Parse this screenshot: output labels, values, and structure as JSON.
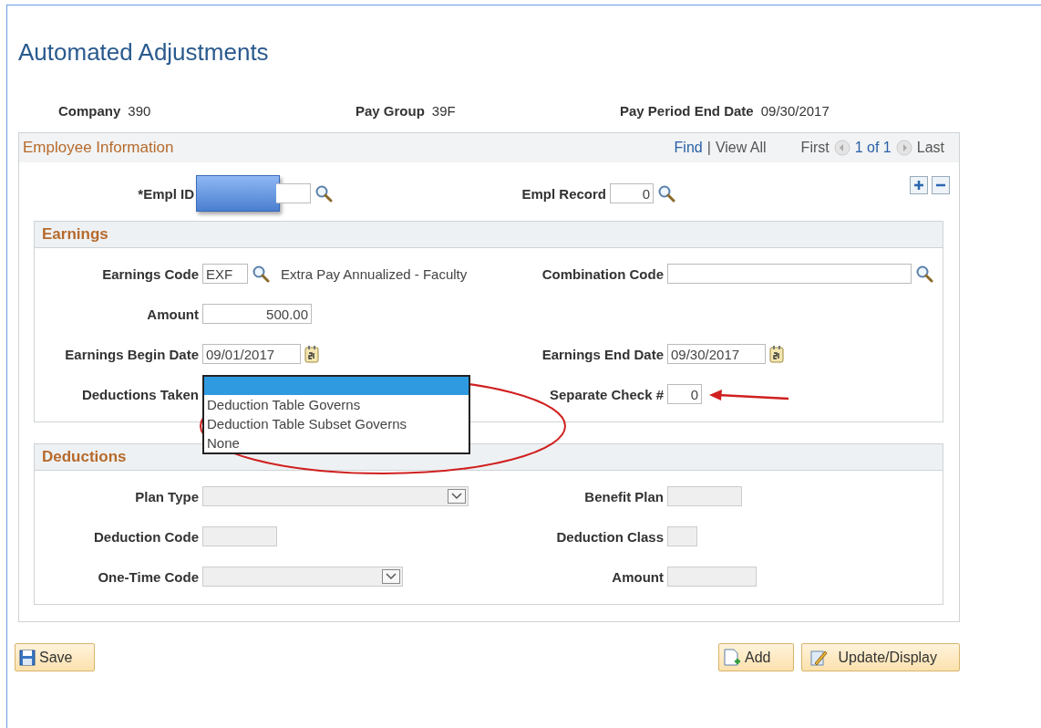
{
  "page": {
    "title": "Automated Adjustments"
  },
  "header_fields": [
    {
      "label": "Company",
      "value": "390"
    },
    {
      "label": "Pay Group",
      "value": "39F"
    },
    {
      "label": "Pay Period End Date",
      "value": "09/30/2017"
    }
  ],
  "employee_panel": {
    "title": "Employee Information",
    "nav": {
      "find": "Find",
      "separator": "|",
      "view_all": "View All",
      "first": "First",
      "count": "1 of 1",
      "last": "Last"
    },
    "empl_id": {
      "label": "*Empl ID"
    },
    "empl_record": {
      "label": "Empl Record",
      "value": "0"
    }
  },
  "earnings": {
    "title": "Earnings",
    "rows": [
      {
        "left": {
          "label": "Earnings Code",
          "kind": "code_lookup",
          "value": "EXF",
          "description": "Extra Pay Annualized - Faculty"
        },
        "right": {
          "label": "Combination Code",
          "kind": "long_lookup"
        }
      },
      {
        "left": {
          "label": "Amount",
          "kind": "amount",
          "value": "500.00"
        }
      },
      {
        "left": {
          "label": "Earnings Begin Date",
          "kind": "date",
          "value": "09/01/2017"
        },
        "right": {
          "label": "Earnings End Date",
          "kind": "date",
          "value": "09/30/2017"
        }
      },
      {
        "left": {
          "label": "Deductions Taken",
          "kind": "open_dropdown",
          "blank_highlighted": true,
          "options": [
            {
              "label": "Deduction Table Governs",
              "selected": false
            },
            {
              "label": "Deduction Table Subset Governs",
              "selected": false
            },
            {
              "label": "None",
              "selected": false
            }
          ]
        },
        "right": {
          "label": "Separate Check #",
          "kind": "small_number",
          "value": "0"
        }
      }
    ]
  },
  "deductions": {
    "title": "Deductions",
    "rows": [
      {
        "left": {
          "label": "Plan Type",
          "kind": "wide_select",
          "disabled": true
        },
        "right": {
          "label": "Benefit Plan",
          "kind": "text",
          "disabled": true
        }
      },
      {
        "left": {
          "label": "Deduction Code",
          "kind": "text",
          "disabled": true
        },
        "right": {
          "label": "Deduction Class",
          "kind": "tiny_text",
          "disabled": true
        }
      },
      {
        "left": {
          "label": "One-Time Code",
          "kind": "select",
          "disabled": true
        },
        "right": {
          "label": "Amount",
          "kind": "text_long",
          "disabled": true
        }
      }
    ]
  },
  "buttons": [
    {
      "label": "Save",
      "kind": "save"
    },
    {
      "label": "Add",
      "kind": "add"
    },
    {
      "label": "Update/Display",
      "kind": "update"
    }
  ]
}
